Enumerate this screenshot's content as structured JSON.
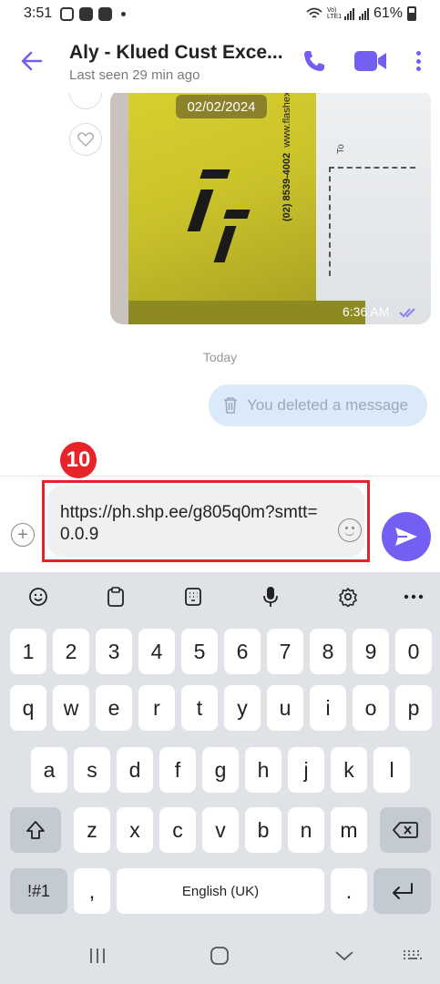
{
  "status_bar": {
    "time": "3:51",
    "battery": "61%",
    "network": "Vo) LTE1"
  },
  "header": {
    "title": "Aly - Klued Cust Exce...",
    "subtitle": "Last seen 29 min ago",
    "icons": [
      "back-arrow-icon",
      "phone-call-icon",
      "video-call-icon",
      "more-vertical-icon"
    ],
    "accent": "#7360f2"
  },
  "chat": {
    "photo_date": "02/02/2024",
    "photo_time": "6:36 AM",
    "package_phone": "(02) 8539-4002",
    "package_site": "www.flashexpress.ph",
    "package_label": "To",
    "day_separator": "Today",
    "deleted_message": "You deleted a message"
  },
  "annotation": {
    "step": "10",
    "color": "#e3232c"
  },
  "composer": {
    "text": "https://ph.shp.ee/g805q0m?smtt=0.0.9"
  },
  "keyboard": {
    "toolbar": [
      "emoji-icon",
      "clipboard-icon",
      "keypad-icon",
      "mic-icon",
      "settings-icon",
      "more-icon"
    ],
    "row_numbers": [
      "1",
      "2",
      "3",
      "4",
      "5",
      "6",
      "7",
      "8",
      "9",
      "0"
    ],
    "row1": [
      "q",
      "w",
      "e",
      "r",
      "t",
      "y",
      "u",
      "i",
      "o",
      "p"
    ],
    "row2": [
      "a",
      "s",
      "d",
      "f",
      "g",
      "h",
      "j",
      "k",
      "l"
    ],
    "row3": [
      "z",
      "x",
      "c",
      "v",
      "b",
      "n",
      "m"
    ],
    "symbols_key": "!#1",
    "comma_key": ",",
    "space_key": "English (UK)",
    "period_key": "."
  }
}
